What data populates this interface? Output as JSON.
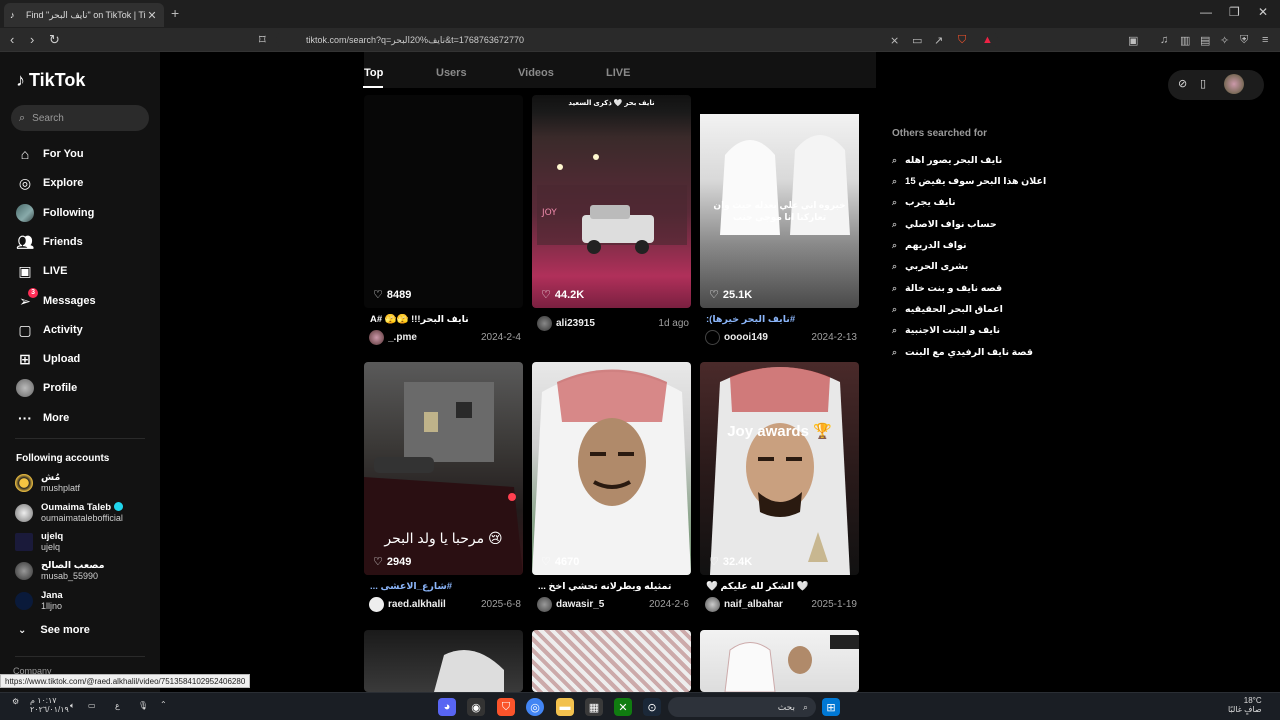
{
  "browser": {
    "tab_title": "Find \"نايف البحر\" on TikTok | TikTo",
    "url": "tiktok.com/search?q=نايف%20البحر&t=1768763672770"
  },
  "sidebar": {
    "logo": "TikTok",
    "search_placeholder": "Search",
    "nav": [
      {
        "label": "For You",
        "icon": "home-icon"
      },
      {
        "label": "Explore",
        "icon": "compass-icon"
      },
      {
        "label": "Following",
        "icon": "avatar-icon"
      },
      {
        "label": "Friends",
        "icon": "friends-icon"
      },
      {
        "label": "LIVE",
        "icon": "live-icon"
      },
      {
        "label": "Messages",
        "icon": "send-icon",
        "badge": "3"
      },
      {
        "label": "Activity",
        "icon": "activity-icon"
      },
      {
        "label": "Upload",
        "icon": "plus-square-icon"
      },
      {
        "label": "Profile",
        "icon": "profile-avatar-icon"
      },
      {
        "label": "More",
        "icon": "more-dots-icon"
      }
    ],
    "following_title": "Following accounts",
    "accounts": [
      {
        "name": "مُش",
        "username": "mushplatf"
      },
      {
        "name": "Oumaima Taleb",
        "username": "oumaimataleb​official",
        "verified": true
      },
      {
        "name": "ujelq",
        "username": "ujelq"
      },
      {
        "name": "مصعب الصالح",
        "username": "musab_55990"
      },
      {
        "name": "Jana",
        "username": "1lljno"
      }
    ],
    "see_more": "See more",
    "company": "Company"
  },
  "search_tabs": [
    "Top",
    "Users",
    "Videos",
    "LIVE"
  ],
  "videos": [
    {
      "likes": "8489",
      "caption": "نايف البحر!!! 🫣🫣 #A",
      "user": "_.pme",
      "date": "2024-2-4",
      "overlay": ""
    },
    {
      "likes": "44.2K",
      "caption": "",
      "user": "ali23915",
      "date": "1d ago",
      "overlay": "نايف بحر 🤍 ذكرى السعيد"
    },
    {
      "likes": "25.1K",
      "caption": "#نايف البحر خيرها):",
      "user": "ooooi149",
      "date": "2024-2-13",
      "overlay": "خبروه اني علي بعدله حيث وان تعاركنا انا موجي جنب"
    },
    {
      "likes": "2949",
      "caption": "#شارع_الاعشى ...",
      "user": "raed.alkhalil",
      "date": "2025-6-8",
      "overlay": "مرحبا يا ولد البحر 😢"
    },
    {
      "likes": "4670",
      "caption": "تمثيله ويطرلانه تحشي اخخ ...",
      "user": "dawasir_5",
      "date": "2024-2-6",
      "overlay": ""
    },
    {
      "likes": "32.4K",
      "caption": "🤍 الشكر لله عليكم 🤍",
      "user": "naif_albahar",
      "date": "2025-1-19",
      "overlay": "Joy awards 🏆"
    }
  ],
  "others_title": "Others searched for",
  "suggestions": [
    "نايف البحر يصور اهله",
    "اعلان هذا البحر سوف يفيض 15",
    "نايف يجرب",
    "حساب نواف الاصلي",
    "نواف الدريهم",
    "بشرى الحربي",
    "قصه نايف و بنت خالة",
    "اعماق البحر الحقيقيه",
    "نايف و البنت الاجنبية",
    "قصة نايف الرفيدي مع البنت"
  ],
  "status_url": "https://www.tiktok.com/@raed.alkhalil/video/7513584102952406280",
  "taskbar": {
    "search": "بحث",
    "time": "١٠:١٧ م",
    "date": "٢٠٢٦/٠١/١٩",
    "weather_temp": "18°C",
    "weather_desc": "صافٍ غالبًا",
    "lang": "ع"
  },
  "colors": {
    "accent": "#fe2c55",
    "hashtag": "#8ab4f8"
  }
}
